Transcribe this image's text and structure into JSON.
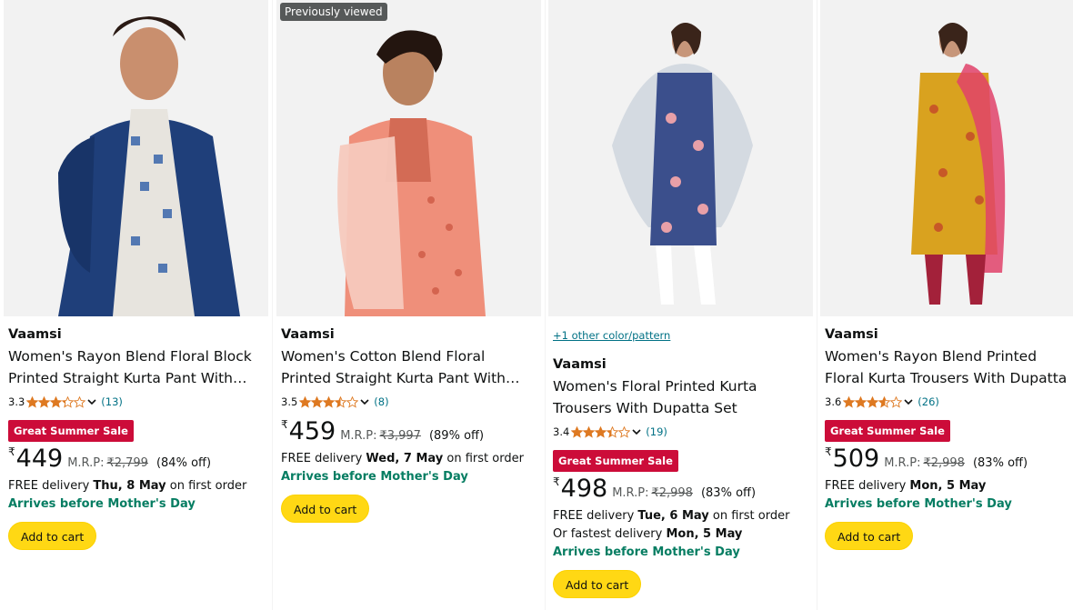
{
  "products": [
    {
      "brand": "Vaamsi",
      "title": "Women's Rayon Blend Floral Block Printed Straight Kurta Pant With…",
      "rating": "3.3",
      "stars": 3.3,
      "reviews": "(13)",
      "sale_badge": "Great Summer Sale",
      "currency": "₹",
      "price": "449",
      "mrp_label": "M.R.P:",
      "mrp": "₹2,799",
      "discount": "(84% off)",
      "delivery_prefix": "FREE delivery",
      "delivery_date": "Thu, 8 May",
      "delivery_suffix": "on first order",
      "arrives": "Arrives before Mother's Day",
      "add_to_cart": "Add to cart",
      "colors": {
        "shirt": "#1f3f7a",
        "bg": "#f2f2f2"
      }
    },
    {
      "badge": "Previously viewed",
      "brand": "Vaamsi",
      "title": "Women's Cotton Blend Floral Printed Straight Kurta Pant With Dupatta Se…",
      "rating": "3.5",
      "stars": 3.5,
      "reviews": "(8)",
      "currency": "₹",
      "price": "459",
      "mrp_label": "M.R.P:",
      "mrp": "₹3,997",
      "discount": "(89% off)",
      "delivery_prefix": "FREE delivery",
      "delivery_date": "Wed, 7 May",
      "delivery_suffix": "on first order",
      "arrives": "Arrives before Mother's Day",
      "add_to_cart": "Add to cart",
      "colors": {
        "shirt": "#ef8f7a",
        "bg": "#f2f2f2"
      }
    },
    {
      "swatch_link": "+1 other color/pattern",
      "brand": "Vaamsi",
      "title": "Women's Floral Printed Kurta Trousers With Dupatta Set",
      "rating": "3.4",
      "stars": 3.4,
      "reviews": "(19)",
      "sale_badge": "Great Summer Sale",
      "currency": "₹",
      "price": "498",
      "mrp_label": "M.R.P:",
      "mrp": "₹2,998",
      "discount": "(83% off)",
      "delivery_prefix": "FREE delivery",
      "delivery_date": "Tue, 6 May",
      "delivery_suffix": "on first order",
      "fastest_prefix": "Or fastest delivery",
      "fastest_date": "Mon, 5 May",
      "arrives": "Arrives before Mother's Day",
      "add_to_cart": "Add to cart",
      "colors": {
        "shirt": "#3b4f8c",
        "bg": "#f2f2f2"
      }
    },
    {
      "brand": "Vaamsi",
      "title": "Women's Rayon Blend Printed Floral Kurta Trousers With Dupatta",
      "rating": "3.6",
      "stars": 3.6,
      "reviews": "(26)",
      "sale_badge": "Great Summer Sale",
      "currency": "₹",
      "price": "509",
      "mrp_label": "M.R.P:",
      "mrp": "₹2,998",
      "discount": "(83% off)",
      "delivery_prefix": "FREE delivery",
      "delivery_date": "Mon, 5 May",
      "arrives": "Arrives before Mother's Day",
      "add_to_cart": "Add to cart",
      "colors": {
        "shirt": "#d9a21f",
        "bg": "#f2f2f2"
      }
    }
  ],
  "colors": {
    "star": "#de7921",
    "sale": "#cc0c39",
    "link": "#007185",
    "arrives": "#067d62",
    "button": "#ffd814"
  }
}
